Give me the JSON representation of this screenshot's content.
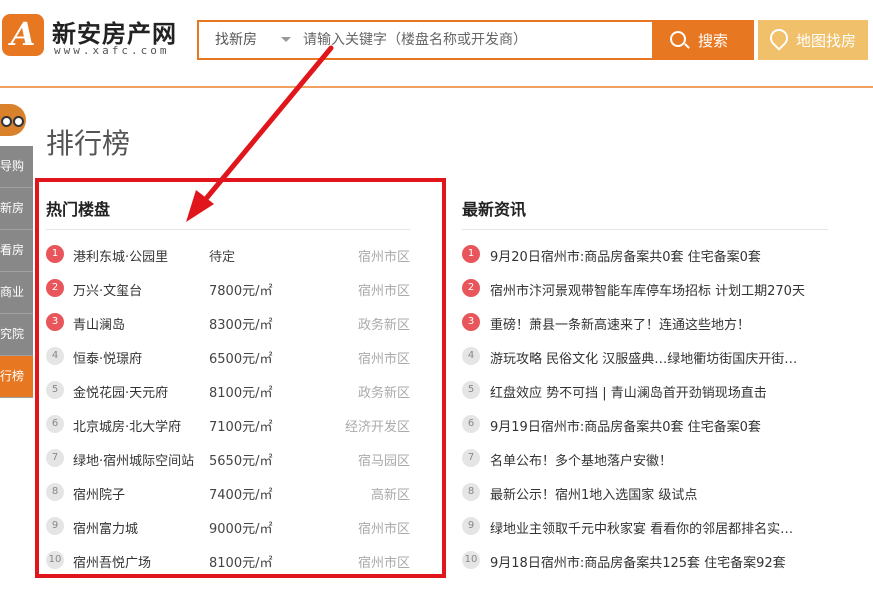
{
  "header": {
    "logo_mark": "A",
    "logo_title": "新安房产网",
    "logo_url": "www.xafc.com",
    "search": {
      "category": "找新房",
      "placeholder": "请输入关键字（楼盘名称或开发商）",
      "button_label": "搜索"
    },
    "map_button_label": "地图找房"
  },
  "sidenav": {
    "items": [
      {
        "label": "导购",
        "active": false
      },
      {
        "label": "新房",
        "active": false
      },
      {
        "label": "看房",
        "active": false
      },
      {
        "label": "商业",
        "active": false
      },
      {
        "label": "究院",
        "active": false
      },
      {
        "label": "行榜",
        "active": true
      }
    ]
  },
  "page_title": "排行榜",
  "hot": {
    "title": "热门楼盘",
    "rows": [
      {
        "rank": "1",
        "name": "港利东城·公园里",
        "price": "待定",
        "area": "宿州市区",
        "top": true
      },
      {
        "rank": "2",
        "name": "万兴·文玺台",
        "price": "7800元/㎡",
        "area": "宿州市区",
        "top": true
      },
      {
        "rank": "3",
        "name": "青山澜岛",
        "price": "8300元/㎡",
        "area": "政务新区",
        "top": true
      },
      {
        "rank": "4",
        "name": "恒泰·悦璟府",
        "price": "6500元/㎡",
        "area": "宿州市区",
        "top": false
      },
      {
        "rank": "5",
        "name": "金悦花园·天元府",
        "price": "8100元/㎡",
        "area": "政务新区",
        "top": false
      },
      {
        "rank": "6",
        "name": "北京城房·北大学府",
        "price": "7100元/㎡",
        "area": "经济开发区",
        "top": false
      },
      {
        "rank": "7",
        "name": "绿地·宿州城际空间站",
        "price": "5650元/㎡",
        "area": "宿马园区",
        "top": false
      },
      {
        "rank": "8",
        "name": "宿州院子",
        "price": "7400元/㎡",
        "area": "高新区",
        "top": false
      },
      {
        "rank": "9",
        "name": "宿州富力城",
        "price": "9000元/㎡",
        "area": "宿州市区",
        "top": false
      },
      {
        "rank": "10",
        "name": "宿州吾悦广场",
        "price": "8100元/㎡",
        "area": "宿州市区",
        "top": false
      }
    ]
  },
  "news": {
    "title": "最新资讯",
    "rows": [
      {
        "rank": "1",
        "text": "9月20日宿州市:商品房备案共0套 住宅备案0套",
        "top": true
      },
      {
        "rank": "2",
        "text": "宿州市汴河景观带智能车库停车场招标 计划工期270天",
        "top": true
      },
      {
        "rank": "3",
        "text": "重磅！萧县一条新高速来了！连通这些地方！",
        "top": true
      },
      {
        "rank": "4",
        "text": "游玩攻略 民俗文化 汉服盛典…绿地衢坊街国庆开街…",
        "top": false
      },
      {
        "rank": "5",
        "text": "红盘效应 势不可挡 | 青山澜岛首开劲销现场直击",
        "top": false
      },
      {
        "rank": "6",
        "text": "9月19日宿州市:商品房备案共0套 住宅备案0套",
        "top": false
      },
      {
        "rank": "7",
        "text": "名单公布！多个基地落户安徽！",
        "top": false
      },
      {
        "rank": "8",
        "text": "最新公示！宿州1地入选国家 级试点",
        "top": false
      },
      {
        "rank": "9",
        "text": "绿地业主领取千元中秋家宴 看看你的邻居都排名实…",
        "top": false
      },
      {
        "rank": "10",
        "text": "9月18日宿州市:商品房备案共125套 住宅备案92套",
        "top": false
      }
    ]
  },
  "colors": {
    "brand_orange": "#e87722",
    "map_button": "#f0c06a",
    "rank_top": "#e8555a",
    "highlight_frame": "#e0161c"
  }
}
